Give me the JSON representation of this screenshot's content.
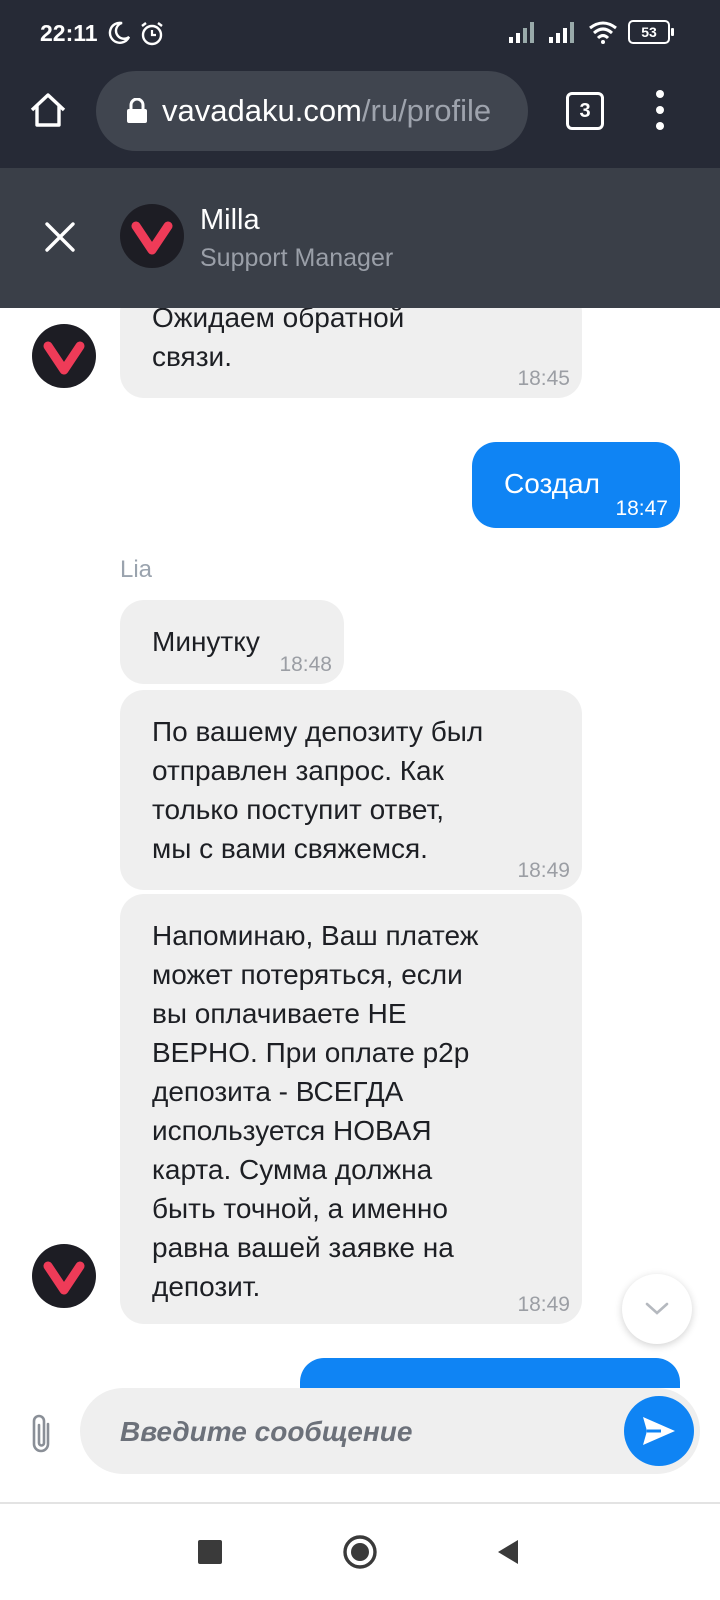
{
  "status_bar": {
    "time": "22:11",
    "battery": "53"
  },
  "browser": {
    "url_domain": "vavadaku.com",
    "url_path": "/ru/profile",
    "tab_count": "3"
  },
  "chat_header": {
    "agent_name": "Milla",
    "agent_role": "Support Manager"
  },
  "messages": [
    {
      "text": "Ожидаем обратной\nсвязи.",
      "time": "18:45"
    },
    {
      "text": "Создал",
      "time": "18:47"
    },
    {
      "text": "Минутку",
      "time": "18:48"
    },
    {
      "text": "По вашему депозиту был\nотправлен запрос. Как\nтолько поступит ответ,\nмы с вами свяжемся.",
      "time": "18:49"
    },
    {
      "text": "Напоминаю, Ваш платеж\nможет потеряться, если\nвы оплачиваете НЕ\nВЕРНО. При оплате p2p\nдепозита - ВСЕГДА\nиспользуется НОВАЯ\nкарта. Сумма должна\nбыть точной, а именно\nравна вашей заявке на\nдепозит.",
      "time": "18:49"
    }
  ],
  "sender_label": "Lia",
  "composer": {
    "placeholder": "Введите сообщение"
  },
  "colors": {
    "status_bg": "#262a36",
    "header_bg": "#3a3f48",
    "accent_blue": "#0f84f4",
    "incoming_bubble": "#efefef",
    "logo_red": "#ef3b58"
  },
  "icons": [
    "home-icon",
    "lock-icon",
    "tabs-icon",
    "more-icon",
    "close-icon",
    "brand-logo",
    "paperclip-icon",
    "send-icon",
    "chevron-down-icon"
  ]
}
